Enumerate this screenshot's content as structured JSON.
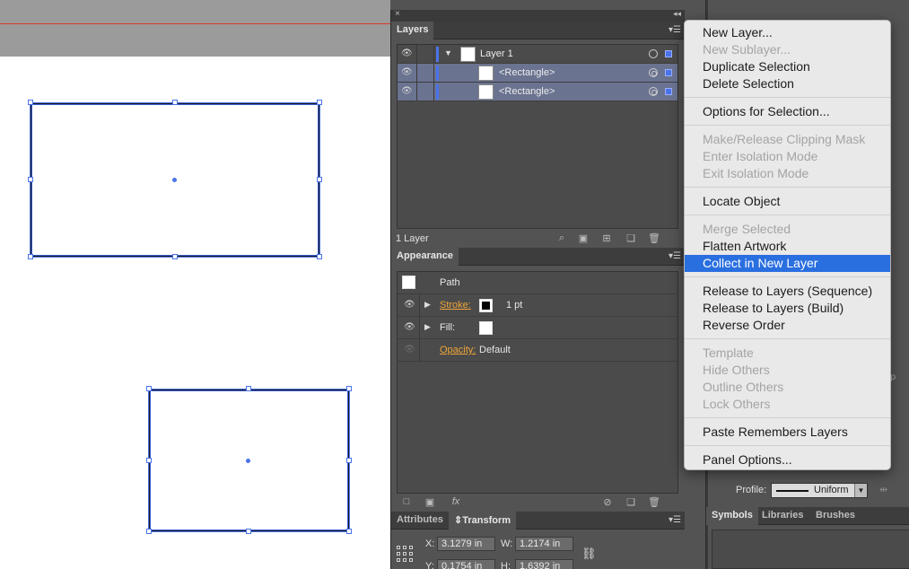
{
  "layers_panel": {
    "tab_label": "Layers",
    "rows": [
      {
        "label": "Layer 1"
      },
      {
        "label": "<Rectangle>"
      },
      {
        "label": "<Rectangle>"
      }
    ],
    "footer_count": "1 Layer"
  },
  "appearance_panel": {
    "tab_label": "Appearance",
    "object_type": "Path",
    "stroke_label": "Stroke:",
    "stroke_weight": "1 pt",
    "fill_label": "Fill:",
    "opacity_label": "Opacity:",
    "opacity_value": "Default",
    "fx_label": "fx"
  },
  "transform_panel": {
    "tab_attributes": "Attributes",
    "tab_transform": "Transform",
    "x_label": "X:",
    "x_value": "3.1279 in",
    "w_label": "W:",
    "w_value": "1.2174 in",
    "y_label": "Y:",
    "y_value": "0.1754 in",
    "h_label": "H:",
    "h_value": "1.6392 in"
  },
  "right_dock": {
    "profile_label": "Profile:",
    "profile_value": "Uniform",
    "tabs": [
      "Symbols",
      "Libraries",
      "Brushes"
    ],
    "fragment_ap": "ap"
  },
  "context_menu": {
    "groups": [
      [
        {
          "label": "New Layer...",
          "enabled": true
        },
        {
          "label": "New Sublayer...",
          "enabled": false
        },
        {
          "label": "Duplicate Selection",
          "enabled": true
        },
        {
          "label": "Delete Selection",
          "enabled": true
        }
      ],
      [
        {
          "label": "Options for Selection...",
          "enabled": true
        }
      ],
      [
        {
          "label": "Make/Release Clipping Mask",
          "enabled": false
        },
        {
          "label": "Enter Isolation Mode",
          "enabled": false
        },
        {
          "label": "Exit Isolation Mode",
          "enabled": false
        }
      ],
      [
        {
          "label": "Locate Object",
          "enabled": true
        }
      ],
      [
        {
          "label": "Merge Selected",
          "enabled": false
        },
        {
          "label": "Flatten Artwork",
          "enabled": true
        },
        {
          "label": "Collect in New Layer",
          "enabled": true,
          "highlighted": true
        }
      ],
      [
        {
          "label": "Release to Layers (Sequence)",
          "enabled": true
        },
        {
          "label": "Release to Layers (Build)",
          "enabled": true
        },
        {
          "label": "Reverse Order",
          "enabled": true
        }
      ],
      [
        {
          "label": "Template",
          "enabled": false
        },
        {
          "label": "Hide Others",
          "enabled": false
        },
        {
          "label": "Outline Others",
          "enabled": false
        },
        {
          "label": "Lock Others",
          "enabled": false
        }
      ],
      [
        {
          "label": "Paste Remembers Layers",
          "enabled": true
        }
      ],
      [
        {
          "label": "Panel Options...",
          "enabled": true
        }
      ]
    ]
  },
  "colors": {
    "highlight": "#2a6fe0",
    "selection_blue": "#4a73e8",
    "guide_red": "#d9382b",
    "attribute_link": "#f0a63a"
  }
}
